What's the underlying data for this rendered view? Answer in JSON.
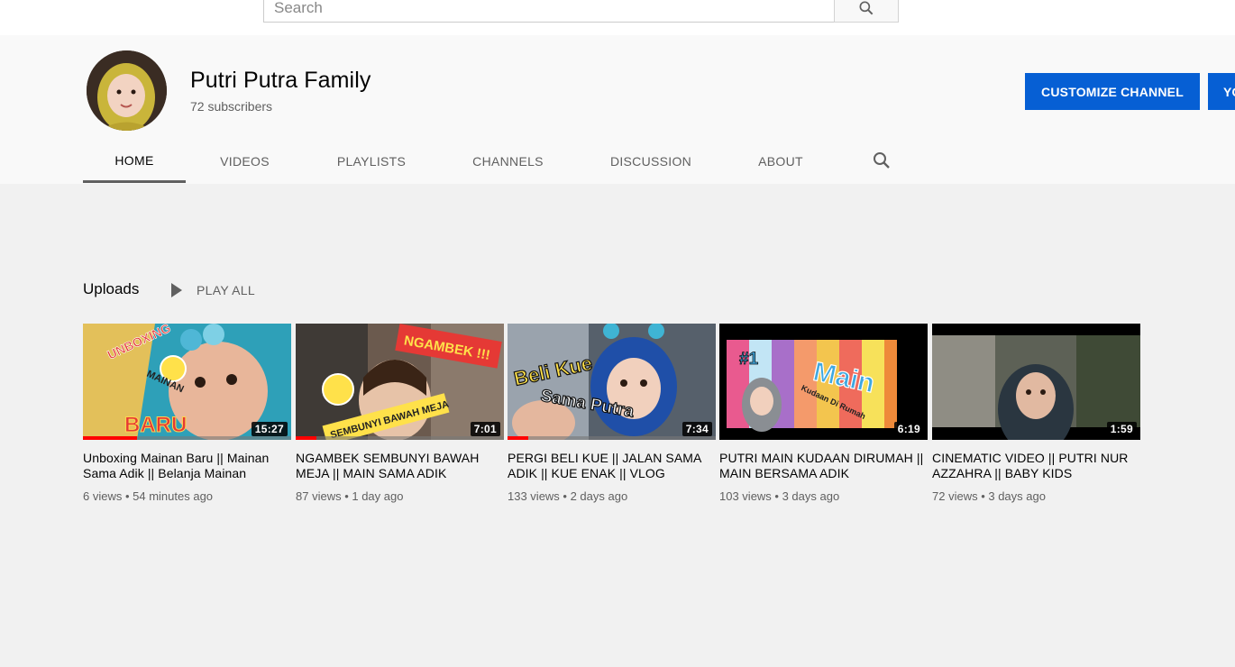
{
  "search": {
    "placeholder": "Search"
  },
  "channel": {
    "name": "Putri Putra Family",
    "subscribers": "72 subscribers",
    "customize_label": "CUSTOMIZE CHANNEL",
    "youtube_studio_label": "YOUTUBE STUDIO"
  },
  "tabs": [
    {
      "label": "HOME",
      "active": true
    },
    {
      "label": "VIDEOS",
      "active": false
    },
    {
      "label": "PLAYLISTS",
      "active": false
    },
    {
      "label": "CHANNELS",
      "active": false
    },
    {
      "label": "DISCUSSION",
      "active": false
    },
    {
      "label": "ABOUT",
      "active": false
    }
  ],
  "uploads": {
    "title": "Uploads",
    "play_all": "PLAY ALL",
    "videos": [
      {
        "title": "Unboxing Mainan Baru || Mainan Sama Adik || Belanja Mainan",
        "views": "6 views",
        "age": "54 minutes ago",
        "duration": "15:27",
        "progress": 0.26,
        "thumb_text": [
          "UNBOXING",
          "MAINAN",
          "BARU"
        ]
      },
      {
        "title": "NGAMBEK SEMBUNYI BAWAH MEJA || MAIN SAMA ADIK",
        "views": "87 views",
        "age": "1 day ago",
        "duration": "7:01",
        "progress": 0.1,
        "thumb_text": [
          "NGAMBEK !!!",
          "SEMBUNYI BAWAH MEJA"
        ]
      },
      {
        "title": "PERGI BELI KUE || JALAN SAMA ADIK || KUE ENAK || VLOG",
        "views": "133 views",
        "age": "2 days ago",
        "duration": "7:34",
        "progress": 0.1,
        "thumb_text": [
          "Beli Kue",
          "Sama Putra"
        ]
      },
      {
        "title": "PUTRI MAIN KUDAAN DIRUMAH || MAIN BERSAMA ADIK",
        "views": "103 views",
        "age": "3 days ago",
        "duration": "6:19",
        "progress": 0,
        "thumb_text": [
          "#1",
          "Main",
          "Kudaan Di Rumah"
        ]
      },
      {
        "title": "CINEMATIC VIDEO || PUTRI NUR AZZAHRA || BABY KIDS",
        "views": "72 views",
        "age": "3 days ago",
        "duration": "1:59",
        "progress": 0,
        "thumb_text": []
      }
    ]
  },
  "colors": {
    "accent": "#065fd4",
    "progress": "#ff0000"
  }
}
